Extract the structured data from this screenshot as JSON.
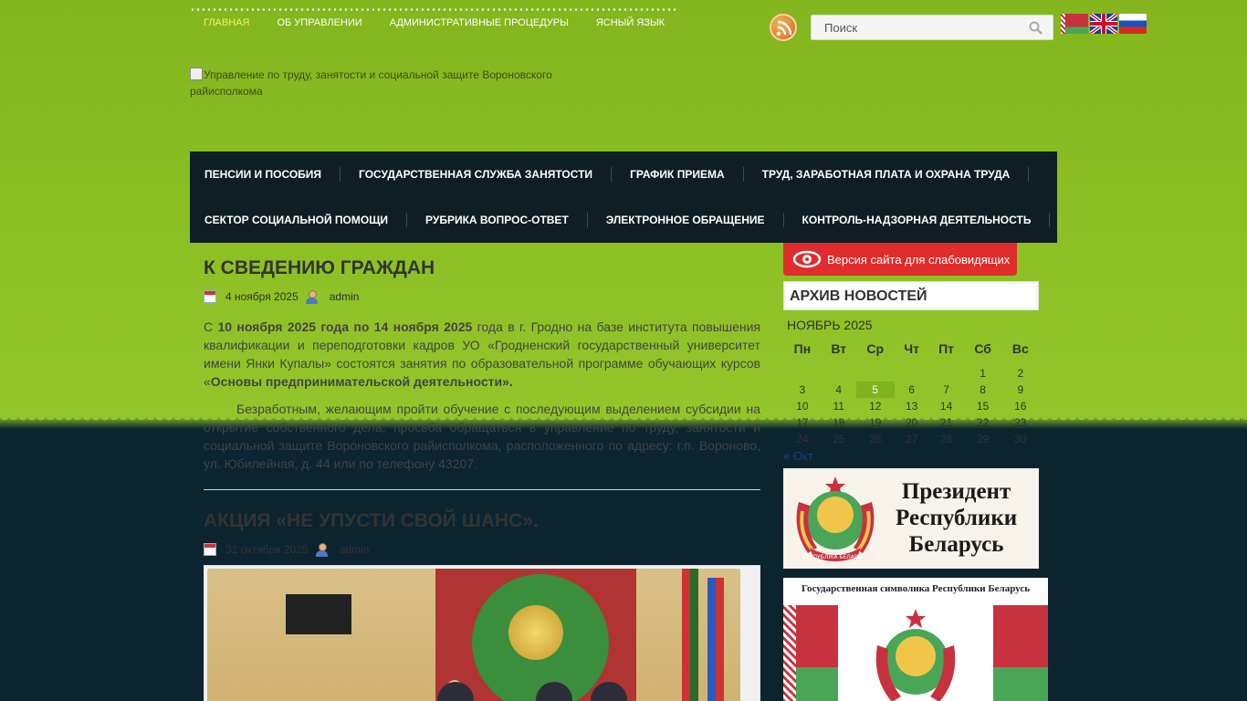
{
  "top_nav": {
    "items": [
      {
        "label": "ГЛАВНАЯ",
        "active": true
      },
      {
        "label": "ОБ УПРАВЛЕНИИ",
        "active": false
      },
      {
        "label": "АДМИНИСТРАТИВНЫЕ ПРОЦЕДУРЫ",
        "active": false
      },
      {
        "label": "ЯСНЫЙ ЯЗЫК",
        "active": false
      }
    ]
  },
  "search": {
    "placeholder": "Поиск"
  },
  "logo": {
    "alt_text": "Управление по труду, занятости и социальной защите Вороновского райисполкома"
  },
  "main_nav": {
    "row1": [
      "ПЕНСИИ И ПОСОБИЯ",
      "ГОСУДАРСТВЕННАЯ СЛУЖБА ЗАНЯТОСТИ",
      "ГРАФИК ПРИЕМА",
      "ТРУД, ЗАРАБОТНАЯ ПЛАТА И ОХРАНА ТРУДА"
    ],
    "row2": [
      "СЕКТОР СОЦИАЛЬНОЙ ПОМОЩИ",
      "РУБРИКА ВОПРОС-ОТВЕТ",
      "ЭЛЕКТРОННОЕ ОБРАЩЕНИЕ",
      "КОНТРОЛЬ-НАДЗОРНАЯ ДЕЯТЕЛЬНОСТЬ"
    ]
  },
  "posts": [
    {
      "title": "К СВЕДЕНИЮ ГРАЖДАН",
      "date": "4 ноября 2025",
      "author": "admin",
      "p1_a": "С ",
      "p1_b": "10 ноября 2025 года по 14 ноября 2025",
      "p1_c": " года в г. Гродно на базе института   повышения  квалификации и переподготовки кадров УО «Гродненский государственный университет имени Янки Купалы» состоятся занятия по образовательной программе обучающих курсов «",
      "p1_d": "Основы предпринимательской деятельности».",
      "p2": "Безработным, желающим пройти обучение с последующим  выделением субсидии на открытие собственного дела, просьба обращаться в управление по труду, занятости и социальной защите Вороновского райисполкома, расположенного по адресу: г.п. Вороново, ул. Юбилейная, д. 44 или по телефону 43207."
    },
    {
      "title": "АКЦИЯ «НЕ УПУСТИ СВОЙ ШАНС».",
      "date": "31 октября 2025",
      "author": "admin"
    }
  ],
  "sidebar": {
    "low_vision_label": "Версия сайта для слабовидящих",
    "archive_title": "АРХИВ НОВОСТЕЙ",
    "calendar": {
      "caption": "НОЯБРЬ 2025",
      "weekdays": [
        "Пн",
        "Вт",
        "Ср",
        "Чт",
        "Пт",
        "Сб",
        "Вс"
      ],
      "weeks": [
        [
          "",
          "",
          "",
          "",
          "",
          "1",
          "2"
        ],
        [
          "3",
          "4",
          "5",
          "6",
          "7",
          "8",
          "9"
        ],
        [
          "10",
          "11",
          "12",
          "13",
          "14",
          "15",
          "16"
        ],
        [
          "17",
          "18",
          "19",
          "20",
          "21",
          "22",
          "23"
        ],
        [
          "24",
          "25",
          "26",
          "27",
          "28",
          "29",
          "30"
        ]
      ],
      "today": "5",
      "prev_link": "« Окт"
    },
    "banner_president": {
      "line1": "Президент",
      "line2": "Республики",
      "line3": "Беларусь",
      "seal_text": "РЭСПУБЛІКА БЕЛАРУСЬ"
    },
    "banner_symbols": {
      "title": "Государственная символика Республики Беларусь"
    }
  },
  "colors": {
    "accent_green": "#7fb21d",
    "nav_bg": "#0e1e24",
    "low_vision_red": "#e02c2c",
    "active_nav": "#f0f25a"
  }
}
